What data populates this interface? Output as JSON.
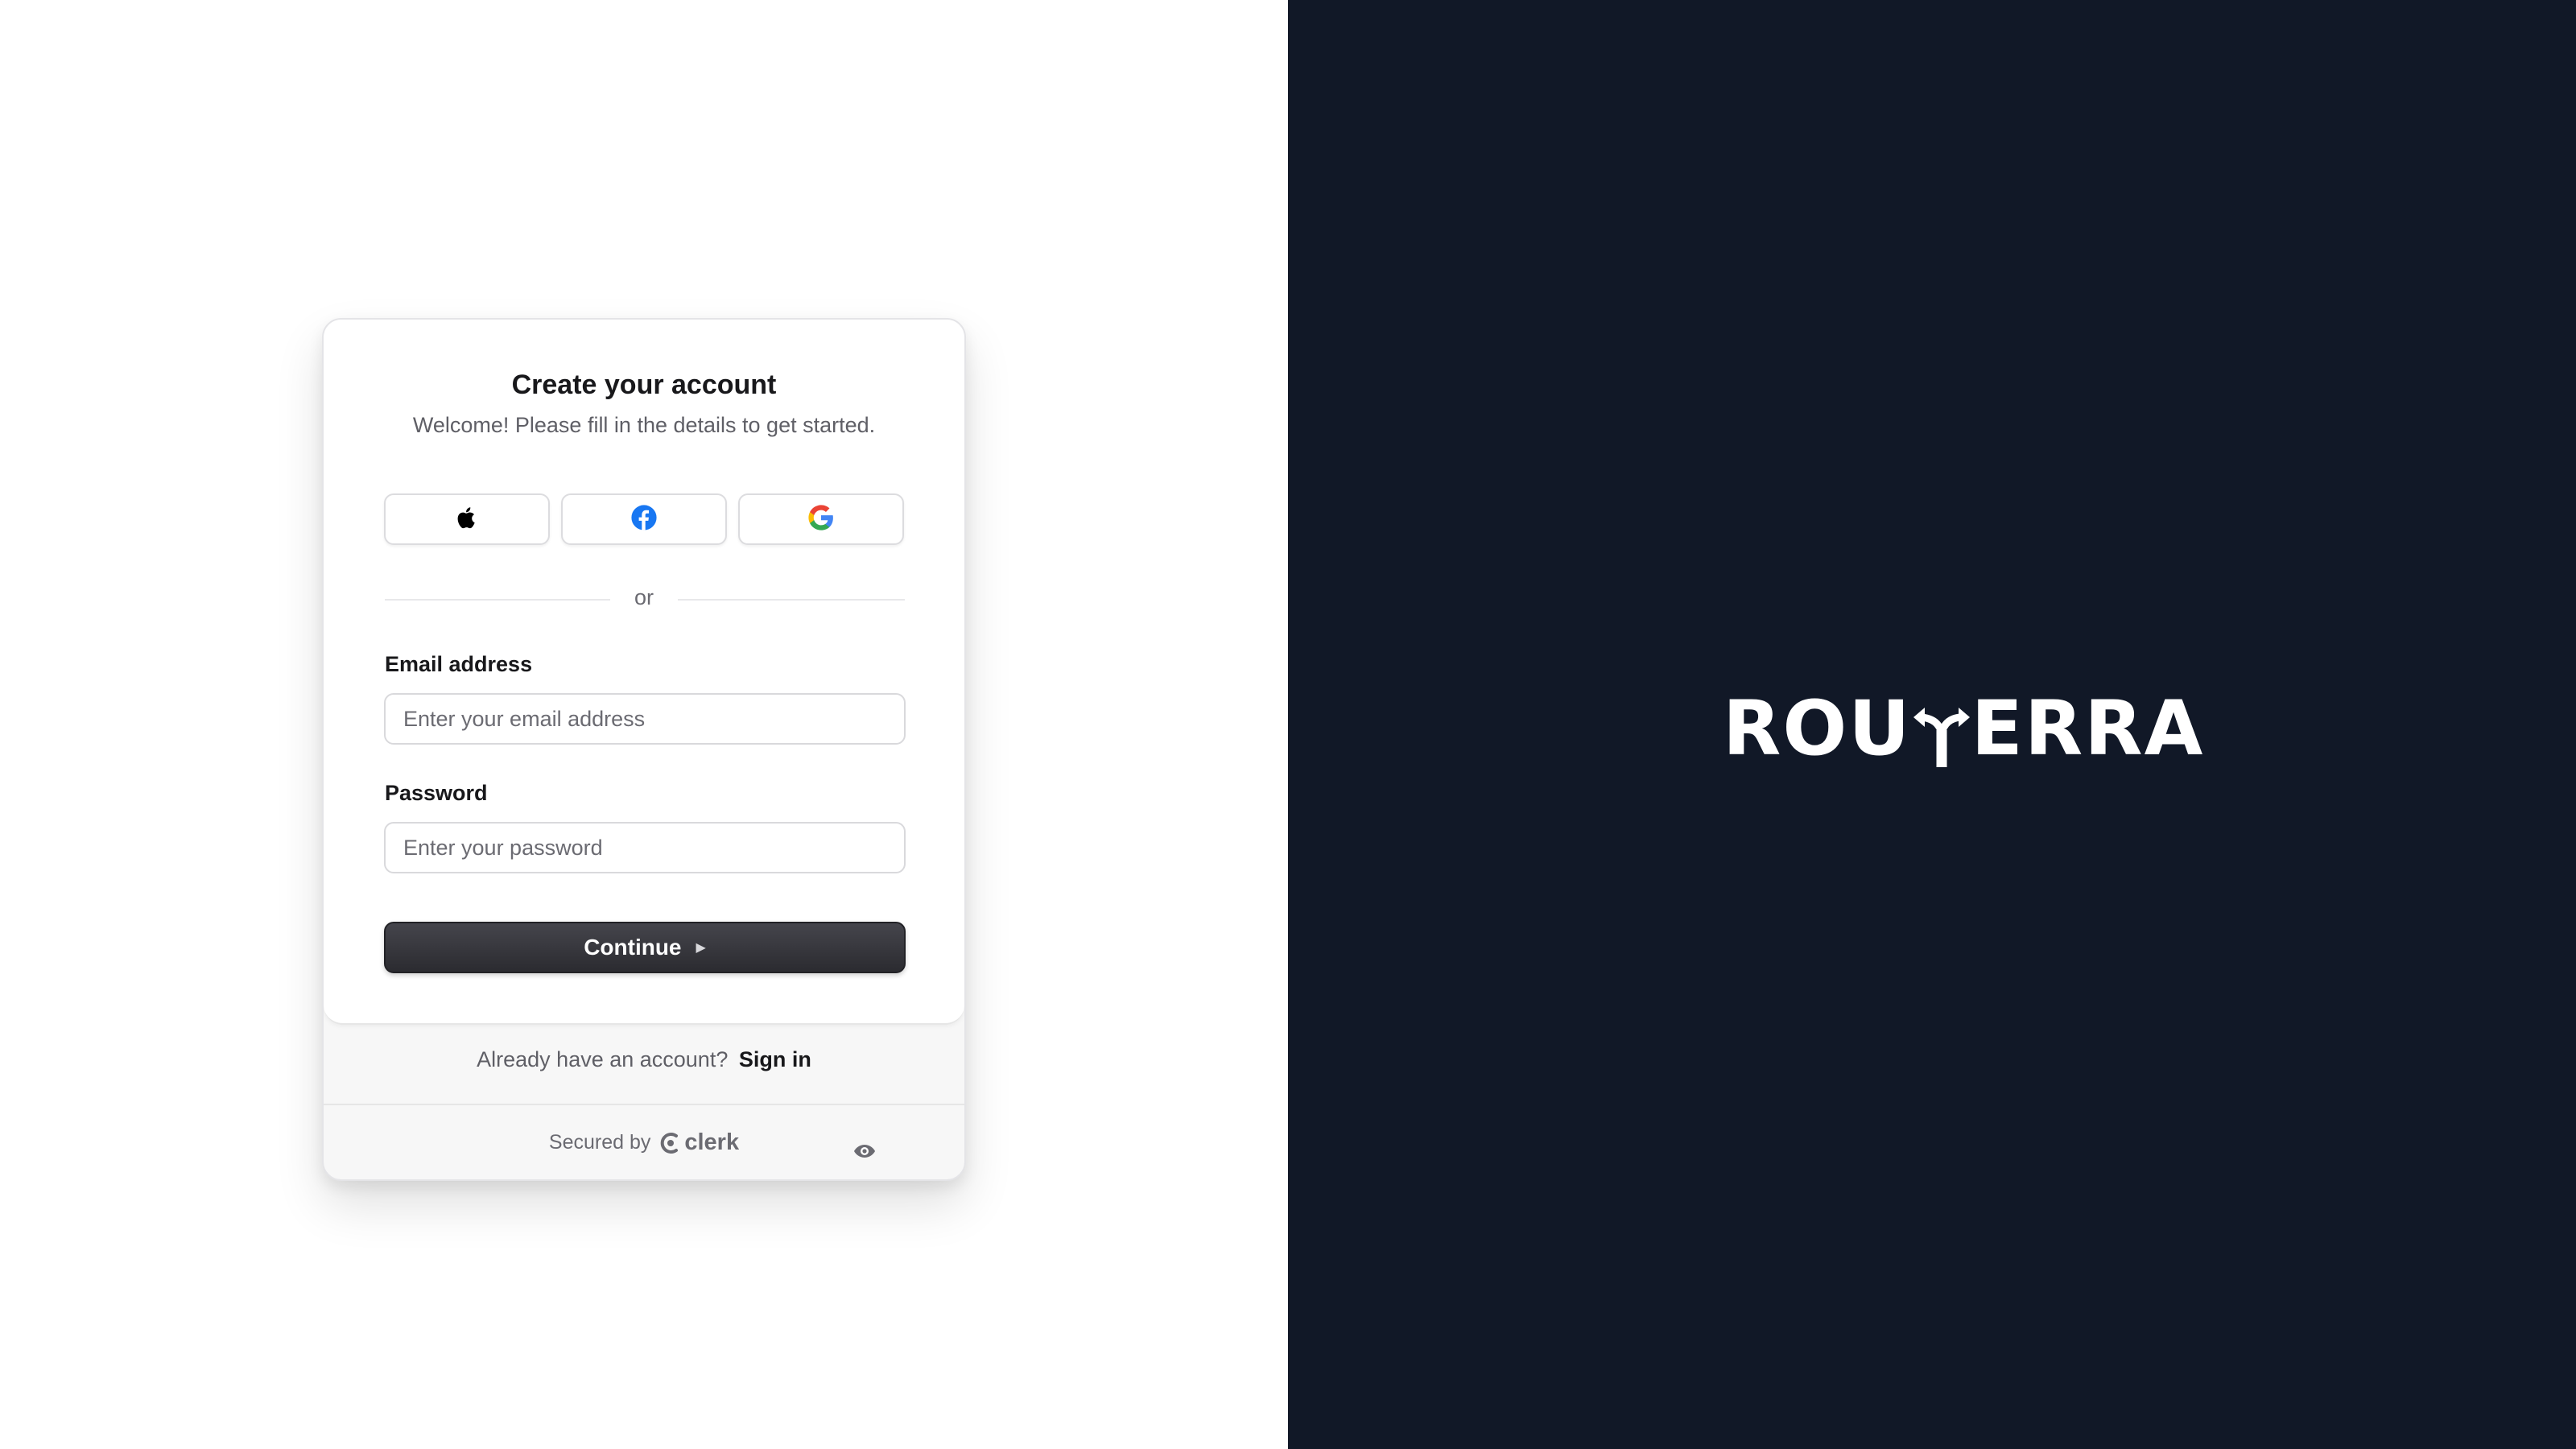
{
  "signup": {
    "title": "Create your account",
    "subtitle": "Welcome! Please fill in the details to get started.",
    "social": [
      {
        "provider": "Apple",
        "icon": "apple-icon"
      },
      {
        "provider": "Facebook",
        "icon": "facebook-icon",
        "color": "#1877F2"
      },
      {
        "provider": "Google",
        "icon": "google-icon"
      }
    ],
    "divider": "or",
    "email": {
      "label": "Email address",
      "placeholder": "Enter your email address",
      "value": ""
    },
    "password": {
      "label": "Password",
      "placeholder": "Enter your password",
      "value": ""
    },
    "continue_label": "Continue",
    "signin_prompt": "Already have an account?",
    "signin_link": "Sign in",
    "secured_by": "Secured by",
    "clerk_brand": "clerk"
  },
  "brand": {
    "logo_left": "ROU",
    "logo_right": "ERRA",
    "logo_alt": "ROUTERRA"
  },
  "colors": {
    "right_panel_bg": "#111827",
    "button_dark": "#2f2f34",
    "text_primary": "#18181b",
    "text_secondary": "#5f5f66"
  }
}
